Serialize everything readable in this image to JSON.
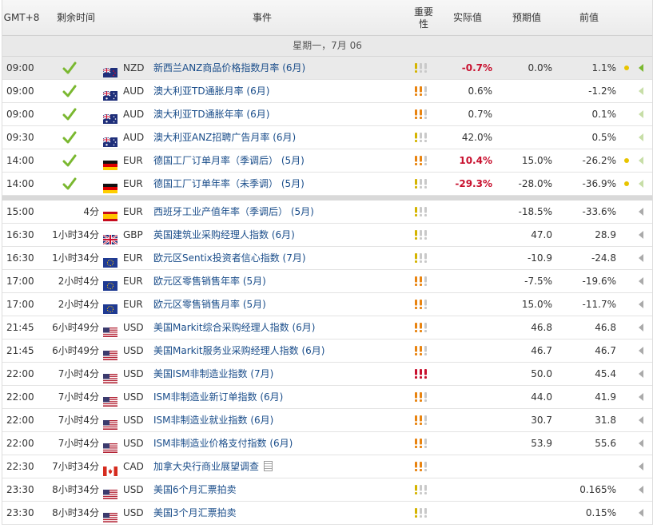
{
  "header": {
    "tz": "GMT+8",
    "remain": "剩余时间",
    "event": "事件",
    "importance": "重要\n性",
    "actual": "实际值",
    "forecast": "预期值",
    "previous": "前值"
  },
  "date_label": "星期一，7月 06",
  "colors": {
    "red": "#c8102e",
    "link": "#1a4d8a",
    "check": "#7ab830",
    "excl_orange": "#e8830f",
    "excl_red": "#c8102e",
    "excl_gray": "#c9c9c9"
  },
  "rows": [
    {
      "time": "09:00",
      "remain": "",
      "done": true,
      "flag": "nz",
      "currency": "NZD",
      "event": "新西兰ANZ商品价格指数月率 (6月)",
      "imp": 1,
      "actual": "-0.7%",
      "actual_red": true,
      "forecast": "0.0%",
      "previous": "1.1%",
      "dot": true,
      "arrow": "g",
      "sel": true
    },
    {
      "time": "09:00",
      "remain": "",
      "done": true,
      "flag": "au",
      "currency": "AUD",
      "event": "澳大利亚TD通胀月率 (6月)",
      "imp": 2,
      "actual": "0.6%",
      "actual_red": false,
      "forecast": "",
      "previous": "-1.2%",
      "dot": false,
      "arrow": "lg"
    },
    {
      "time": "09:00",
      "remain": "",
      "done": true,
      "flag": "au",
      "currency": "AUD",
      "event": "澳大利亚TD通胀年率 (6月)",
      "imp": 2,
      "actual": "0.7%",
      "actual_red": false,
      "forecast": "",
      "previous": "0.1%",
      "dot": false,
      "arrow": "lg"
    },
    {
      "time": "09:30",
      "remain": "",
      "done": true,
      "flag": "au",
      "currency": "AUD",
      "event": "澳大利亚ANZ招聘广告月率 (6月)",
      "imp": 1,
      "actual": "42.0%",
      "actual_red": false,
      "forecast": "",
      "previous": "0.5%",
      "dot": false,
      "arrow": "lg"
    },
    {
      "time": "14:00",
      "remain": "",
      "done": true,
      "flag": "de",
      "currency": "EUR",
      "event": "德国工厂订单月率（季调后） (5月)",
      "imp": 2,
      "actual": "10.4%",
      "actual_red": true,
      "forecast": "15.0%",
      "previous": "-26.2%",
      "dot": true,
      "arrow": "lg"
    },
    {
      "time": "14:00",
      "remain": "",
      "done": true,
      "flag": "de",
      "currency": "EUR",
      "event": "德国工厂订单年率（未季调） (5月)",
      "imp": 1,
      "actual": "-29.3%",
      "actual_red": true,
      "forecast": "-28.0%",
      "previous": "-36.9%",
      "dot": true,
      "arrow": "lg",
      "sep_after": true
    },
    {
      "time": "15:00",
      "remain": "4分",
      "done": false,
      "flag": "es",
      "currency": "EUR",
      "event": "西班牙工业产值年率（季调后） (5月)",
      "imp": 1,
      "actual": "",
      "actual_red": false,
      "forecast": "-18.5%",
      "previous": "-33.6%",
      "dot": false,
      "arrow": ""
    },
    {
      "time": "16:30",
      "remain": "1小时34分",
      "done": false,
      "flag": "gb",
      "currency": "GBP",
      "event": "英国建筑业采购经理人指数 (6月)",
      "imp": 1,
      "actual": "",
      "actual_red": false,
      "forecast": "47.0",
      "previous": "28.9",
      "dot": false,
      "arrow": ""
    },
    {
      "time": "16:30",
      "remain": "1小时34分",
      "done": false,
      "flag": "eu",
      "currency": "EUR",
      "event": "欧元区Sentix投资者信心指数 (7月)",
      "imp": 1,
      "actual": "",
      "actual_red": false,
      "forecast": "-10.9",
      "previous": "-24.8",
      "dot": false,
      "arrow": ""
    },
    {
      "time": "17:00",
      "remain": "2小时4分",
      "done": false,
      "flag": "eu",
      "currency": "EUR",
      "event": "欧元区零售销售年率 (5月)",
      "imp": 2,
      "actual": "",
      "actual_red": false,
      "forecast": "-7.5%",
      "previous": "-19.6%",
      "dot": false,
      "arrow": ""
    },
    {
      "time": "17:00",
      "remain": "2小时4分",
      "done": false,
      "flag": "eu",
      "currency": "EUR",
      "event": "欧元区零售销售月率 (5月)",
      "imp": 2,
      "actual": "",
      "actual_red": false,
      "forecast": "15.0%",
      "previous": "-11.7%",
      "dot": false,
      "arrow": ""
    },
    {
      "time": "21:45",
      "remain": "6小时49分",
      "done": false,
      "flag": "us",
      "currency": "USD",
      "event": "美国Markit综合采购经理人指数 (6月)",
      "imp": 2,
      "actual": "",
      "actual_red": false,
      "forecast": "46.8",
      "previous": "46.8",
      "dot": false,
      "arrow": ""
    },
    {
      "time": "21:45",
      "remain": "6小时49分",
      "done": false,
      "flag": "us",
      "currency": "USD",
      "event": "美国Markit服务业采购经理人指数 (6月)",
      "imp": 2,
      "actual": "",
      "actual_red": false,
      "forecast": "46.7",
      "previous": "46.7",
      "dot": false,
      "arrow": ""
    },
    {
      "time": "22:00",
      "remain": "7小时4分",
      "done": false,
      "flag": "us",
      "currency": "USD",
      "event": "美国ISM非制造业指数 (7月)",
      "imp": 3,
      "actual": "",
      "actual_red": false,
      "forecast": "50.0",
      "previous": "45.4",
      "dot": false,
      "arrow": ""
    },
    {
      "time": "22:00",
      "remain": "7小时4分",
      "done": false,
      "flag": "us",
      "currency": "USD",
      "event": "ISM非制造业新订单指数 (6月)",
      "imp": 2,
      "actual": "",
      "actual_red": false,
      "forecast": "44.0",
      "previous": "41.9",
      "dot": false,
      "arrow": ""
    },
    {
      "time": "22:00",
      "remain": "7小时4分",
      "done": false,
      "flag": "us",
      "currency": "USD",
      "event": "ISM非制造业就业指数 (6月)",
      "imp": 2,
      "actual": "",
      "actual_red": false,
      "forecast": "30.7",
      "previous": "31.8",
      "dot": false,
      "arrow": ""
    },
    {
      "time": "22:00",
      "remain": "7小时4分",
      "done": false,
      "flag": "us",
      "currency": "USD",
      "event": "ISM非制造业价格支付指数 (6月)",
      "imp": 2,
      "actual": "",
      "actual_red": false,
      "forecast": "53.9",
      "previous": "55.6",
      "dot": false,
      "arrow": ""
    },
    {
      "time": "22:30",
      "remain": "7小时34分",
      "done": false,
      "flag": "ca",
      "currency": "CAD",
      "event": "加拿大央行商业展望调查",
      "imp": 2,
      "actual": "",
      "actual_red": false,
      "forecast": "",
      "previous": "",
      "dot": false,
      "arrow": "",
      "doc": true
    },
    {
      "time": "23:30",
      "remain": "8小时34分",
      "done": false,
      "flag": "us",
      "currency": "USD",
      "event": "美国6个月汇票拍卖",
      "imp": 1,
      "actual": "",
      "actual_red": false,
      "forecast": "",
      "previous": "0.165%",
      "dot": false,
      "arrow": ""
    },
    {
      "time": "23:30",
      "remain": "8小时34分",
      "done": false,
      "flag": "us",
      "currency": "USD",
      "event": "美国3个月汇票拍卖",
      "imp": 1,
      "actual": "",
      "actual_red": false,
      "forecast": "",
      "previous": "0.15%",
      "dot": false,
      "arrow": ""
    }
  ]
}
